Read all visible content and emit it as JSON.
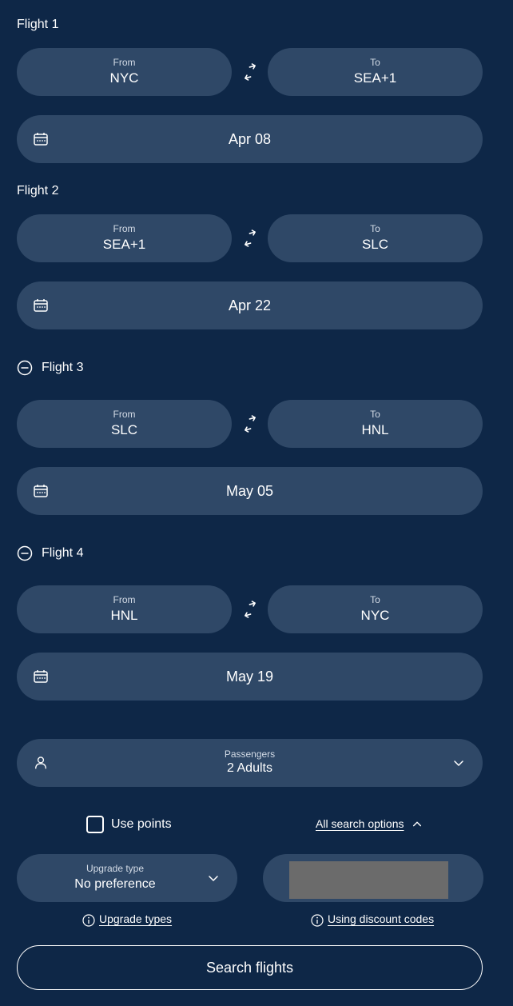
{
  "flights": [
    {
      "heading": "Flight 1",
      "from_label": "From",
      "from": "NYC",
      "to_label": "To",
      "to": "SEA+1",
      "date": "Apr 08",
      "removable": false
    },
    {
      "heading": "Flight 2",
      "from_label": "From",
      "from": "SEA+1",
      "to_label": "To",
      "to": "SLC",
      "date": "Apr 22",
      "removable": false
    },
    {
      "heading": "Flight 3",
      "from_label": "From",
      "from": "SLC",
      "to_label": "To",
      "to": "HNL",
      "date": "May 05",
      "removable": true
    },
    {
      "heading": "Flight 4",
      "from_label": "From",
      "from": "HNL",
      "to_label": "To",
      "to": "NYC",
      "date": "May 19",
      "removable": true
    }
  ],
  "passengers": {
    "label": "Passengers",
    "value": "2 Adults"
  },
  "use_points": {
    "label": "Use points",
    "checked": false
  },
  "all_search_options": {
    "label": "All search options"
  },
  "upgrade": {
    "label": "Upgrade type",
    "value": "No preference"
  },
  "upgrade_types_link": "Upgrade types",
  "discount_codes_link": "Using discount codes",
  "search_button": "Search flights",
  "colors": {
    "background": "#0e2747",
    "pill": "#2f4867",
    "text": "#ffffff"
  }
}
